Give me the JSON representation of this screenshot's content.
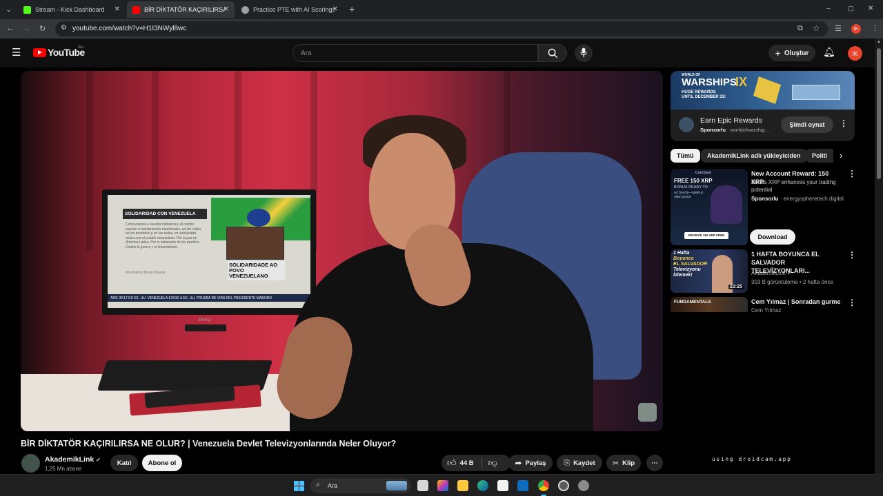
{
  "browser": {
    "tabs": [
      {
        "title": "Stream - Kick Dashboard",
        "favicon_color": "#53fc18",
        "active": false
      },
      {
        "title": "BİR DİKTATÖR KAÇIRILIRSA NE",
        "favicon_color": "#ff0000",
        "active": true
      },
      {
        "title": "Practice PTE with AI Scorings -",
        "favicon_color": "#9aa0a6",
        "active": false
      }
    ],
    "new_tab_label": "+",
    "url": "youtube.com/watch?v=H1I3NWyl8wc",
    "profile_initials": "IK"
  },
  "youtube": {
    "logo_text": "YouTube",
    "region": "AU",
    "search_placeholder": "Ara",
    "create_label": "Oluştur",
    "avatar_initials": "IK",
    "video": {
      "title": "BİR DİKTATÖR KAÇIRILIRSA NE OLUR? | Venezuela Devlet Televizyonlarında Neler Oluyor?",
      "monitor_brand": "BenQ",
      "screen_headline": "SOLIDARIDAD CON VENEZUELA",
      "screen_overlay": "SOLIDARIDADE AO POVO VENEZUELANO",
      "screen_ticker": "ARG  09:17 ES  EE. UU. VENEZUELA EXIGE A EE. UU. PRUEBA DE VIDA DEL PRESIDENTE MADURO",
      "screen_body": "Convocamos a nuestra militancia y al campo popular a mantenernos movilizados, en las calles, en los territorios y en las redes, en solidaridad activa con el pueblo venezolano. Por la paz en América Latina. Por la soberanía de los pueblos. Contra la guerra y el imperialismo.",
      "screen_signature": "Movimiento Brasil Popular"
    },
    "channel": {
      "name": "AkademikLink",
      "subscribers": "1,25 Mn abone",
      "join_label": "Katıl",
      "subscribe_label": "Abone ol"
    },
    "actions": {
      "likes": "44 B",
      "share": "Paylaş",
      "save": "Kaydet",
      "clip": "Klip"
    },
    "ad": {
      "banner_title": "WARSHIPS",
      "banner_brand": "WORLD OF",
      "banner_level": "IX",
      "banner_sub_1": "HUGE REWARDS",
      "banner_sub_2": "UNTIL DECEMBER 31!",
      "title": "Earn Epic Rewards",
      "sponsored": "Sponsorlu",
      "domain": "· worldofwarship...",
      "cta": "Şimdi oynat"
    },
    "chips": [
      "Tümü",
      "AkademikLink adlı yükleyiciden",
      "Politi"
    ],
    "recommendations": [
      {
        "title": "New Account Reward: 150 XRP",
        "desc": "Bonus XRP enhances your trading potential",
        "sponsored": "Sponsorlu",
        "domain": "· energyspheretech.digital",
        "cta": "Download",
        "thumb_line1": "FREE 150 XRP",
        "thumb_line2": "BONUS READY TO",
        "thumb_line3": "ACTIVATE—SIMPLE AND QUICK",
        "thumb_button": "RECEIVE 150 XRP FREE",
        "thumb_brand": "CoinSpot"
      },
      {
        "title": "1 HAFTA BOYUNCA EL SALVADOR TELEVİZYONLARI...",
        "channel": "AkademikLink",
        "views": "303 B görüntüleme",
        "age": "2 hafta önce",
        "duration": "23:25",
        "thumb_line1": "1 Hafta",
        "thumb_line2": "Boyunca",
        "thumb_line3": "EL SALVADOR",
        "thumb_line4": "Televizyonu",
        "thumb_line5": "İzlemek!"
      },
      {
        "title": "Cem Yılmaz | Sonradan gurme",
        "channel": "Cem Yılmaz",
        "thumb_label": "FUNDAMENTALS"
      }
    ],
    "overlay_text": "using droidcam.app"
  },
  "taskbar": {
    "search_placeholder": "Ara"
  }
}
